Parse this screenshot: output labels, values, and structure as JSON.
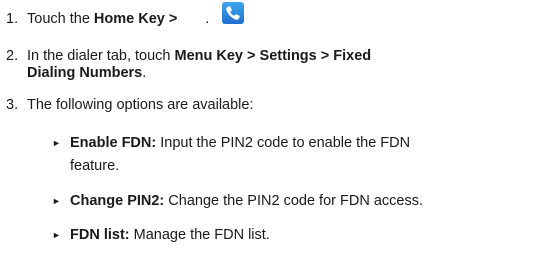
{
  "steps": [
    {
      "number": "1.",
      "prefix": "Touch the ",
      "bold": "Home Key >",
      "suffix": "."
    },
    {
      "number": "2.",
      "prefix": "In the dialer tab, touch ",
      "bold1": "Menu Key > Settings > Fixed",
      "bold2": "Dialing Numbers",
      "suffix": "."
    },
    {
      "number": "3.",
      "text": "The following options are available:"
    }
  ],
  "options": [
    {
      "bullet": "►",
      "label": "Enable FDN:",
      "text": " Input the PIN2 code to enable the FDN",
      "text2": "feature."
    },
    {
      "bullet": "►",
      "label": "Change PIN2:",
      "text": " Change the PIN2 code for FDN access."
    },
    {
      "bullet": "►",
      "label": "FDN list:",
      "text": " Manage the FDN list."
    }
  ],
  "icon": "phone-dialer-icon",
  "colors": {
    "icon": "#2f86e0",
    "text": "#1a1a1a"
  }
}
